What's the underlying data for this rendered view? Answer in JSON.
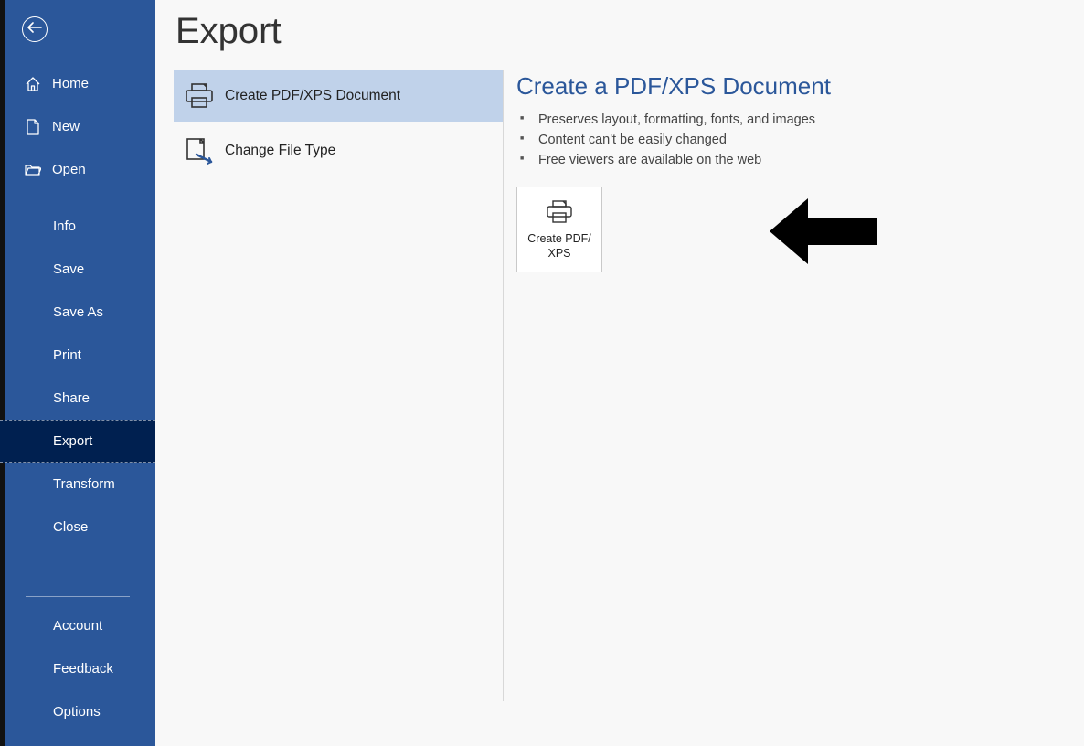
{
  "page": {
    "title": "Export"
  },
  "sidebar": {
    "primary": [
      {
        "label": "Home"
      },
      {
        "label": "New"
      },
      {
        "label": "Open"
      }
    ],
    "middle": [
      {
        "label": "Info"
      },
      {
        "label": "Save"
      },
      {
        "label": "Save As"
      },
      {
        "label": "Print"
      },
      {
        "label": "Share"
      },
      {
        "label": "Export"
      },
      {
        "label": "Transform"
      },
      {
        "label": "Close"
      }
    ],
    "bottom": [
      {
        "label": "Account"
      },
      {
        "label": "Feedback"
      },
      {
        "label": "Options"
      }
    ]
  },
  "exportOptions": [
    {
      "label": "Create PDF/XPS Document"
    },
    {
      "label": "Change File Type"
    }
  ],
  "detail": {
    "title": "Create a PDF/XPS Document",
    "bullets": [
      "Preserves layout, formatting, fonts, and images",
      "Content can't be easily changed",
      "Free viewers are available on the web"
    ],
    "actionButton": {
      "line1": "Create PDF/",
      "line2": "XPS"
    }
  }
}
